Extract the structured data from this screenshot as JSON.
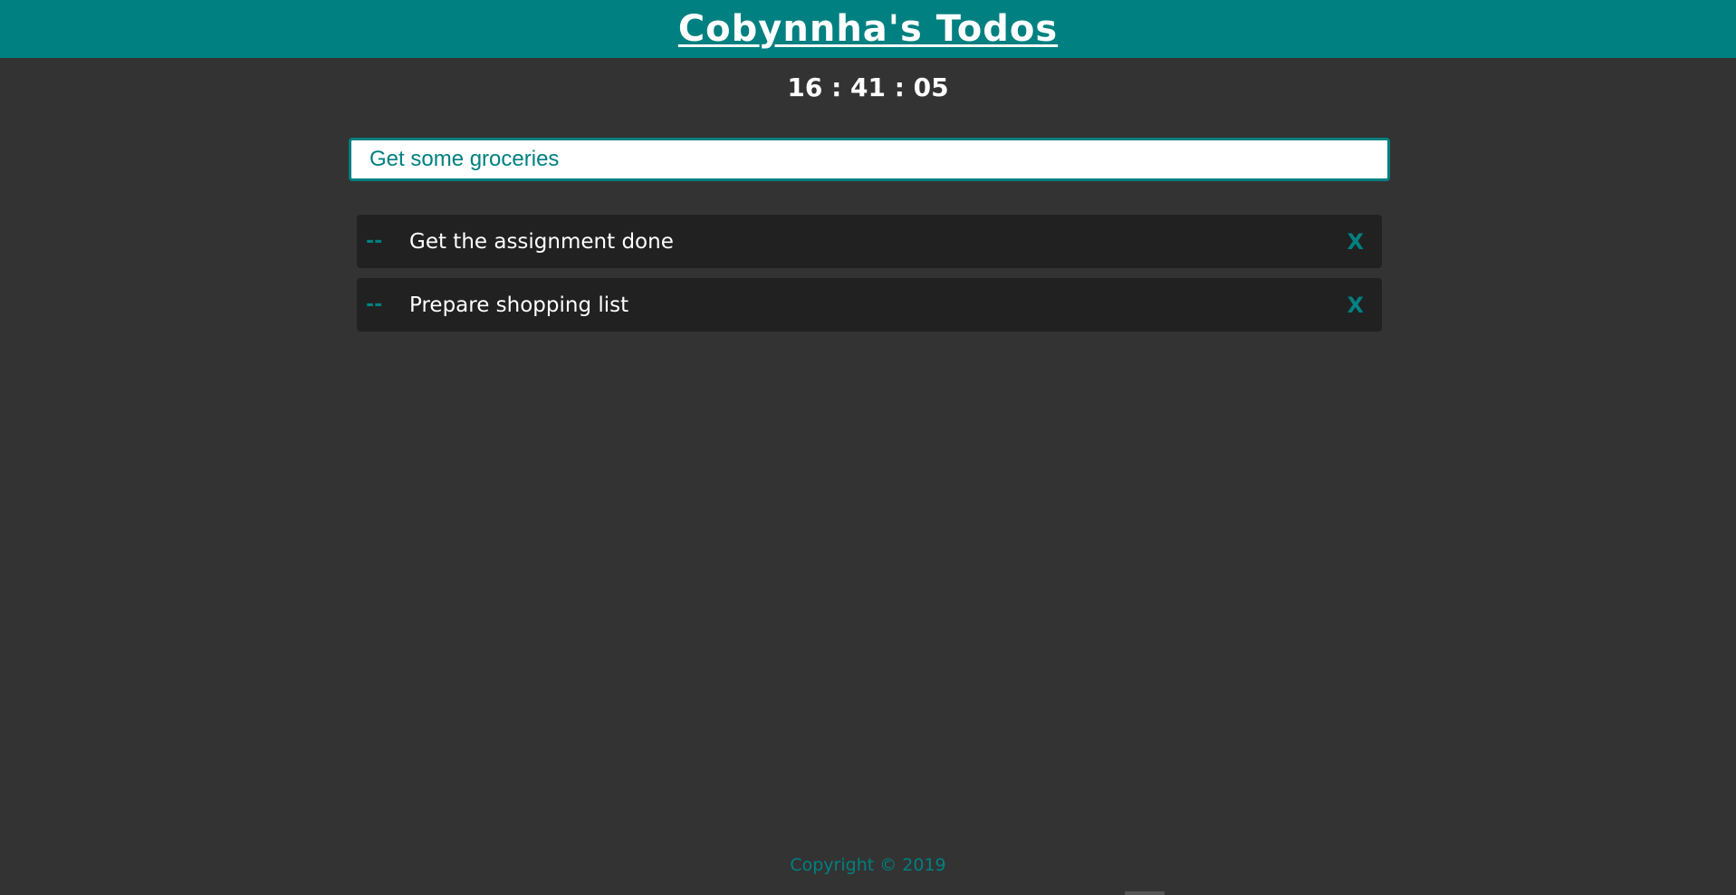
{
  "header": {
    "title": "Cobynnha's Todos"
  },
  "clock": {
    "time": "16 : 41 : 05"
  },
  "input": {
    "value": "Get some groceries"
  },
  "todos": [
    {
      "bullet": "--",
      "text": "Get the assignment done",
      "delete_label": "X"
    },
    {
      "bullet": "--",
      "text": "Prepare shopping list",
      "delete_label": "X"
    }
  ],
  "footer": {
    "copyright": "Copyright © 2019"
  },
  "colors": {
    "accent": "#008080",
    "background": "#333333",
    "item_background": "#212121",
    "text": "#ffffff"
  }
}
